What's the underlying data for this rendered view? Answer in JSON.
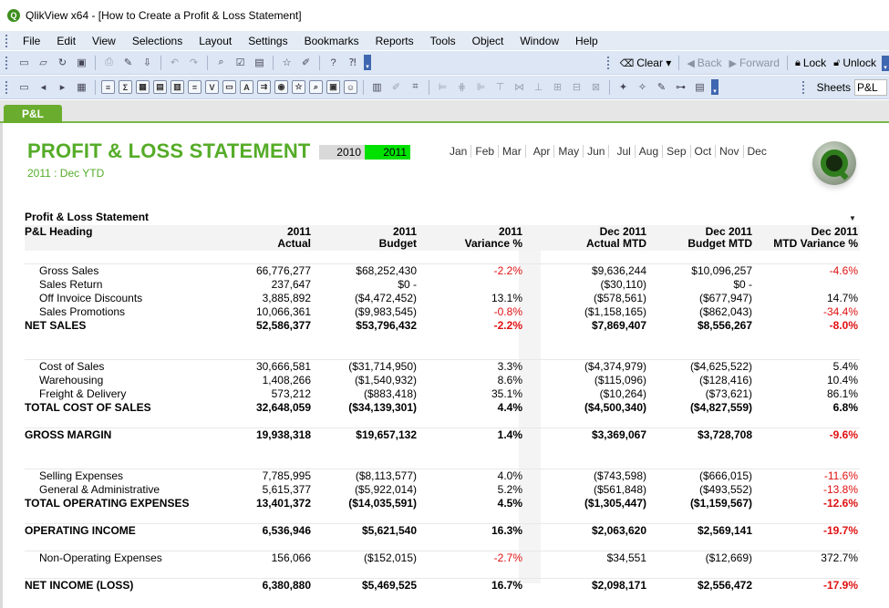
{
  "window": {
    "title": "QlikView x64 - [How to Create a Profit & Loss Statement]",
    "logo_letter": "Q"
  },
  "menu": [
    "File",
    "Edit",
    "View",
    "Selections",
    "Layout",
    "Settings",
    "Bookmarks",
    "Reports",
    "Tools",
    "Object",
    "Window",
    "Help"
  ],
  "toolbar": {
    "clear_label": "Clear",
    "back_label": "Back",
    "forward_label": "Forward",
    "lock_label": "Lock",
    "unlock_label": "Unlock",
    "sheets_label": "Sheets",
    "sheets_value": "P&L"
  },
  "sheet_tab": "P&L",
  "page": {
    "title": "PROFIT & LOSS STATEMENT",
    "subtitle": "2011 : Dec YTD",
    "years": [
      {
        "label": "2010",
        "selected": false
      },
      {
        "label": "2011",
        "selected": true
      }
    ],
    "months": [
      "Jan",
      "Feb",
      "Mar",
      "Apr",
      "May",
      "Jun",
      "Jul",
      "Aug",
      "Sep",
      "Oct",
      "Nov",
      "Dec"
    ],
    "selected_color": "#00e100",
    "brand_color": "#55ac28"
  },
  "table": {
    "caption": "Profit & Loss Statement",
    "menu_glyph": "▼",
    "headers": [
      [
        "P&L Heading",
        ""
      ],
      [
        "2011",
        "Actual"
      ],
      [
        "2011",
        "Budget"
      ],
      [
        "2011",
        "Variance %"
      ],
      [
        "Dec 2011",
        "Actual MTD"
      ],
      [
        "Dec 2011",
        "Budget MTD"
      ],
      [
        "Dec 2011",
        "MTD Variance %"
      ]
    ],
    "rows": [
      {
        "type": "blank",
        "line": true
      },
      {
        "type": "item",
        "cells": [
          "Gross Sales",
          "66,776,277",
          "$68,252,430",
          "-2.2%",
          "$9,636,244",
          "$10,096,257",
          "-4.6%"
        ],
        "neg": [
          3,
          6
        ]
      },
      {
        "type": "item",
        "cells": [
          "Sales Return",
          "237,647",
          "$0 -",
          "",
          "($30,110)",
          "$0 -",
          ""
        ],
        "neg": []
      },
      {
        "type": "item",
        "cells": [
          "Off Invoice Discounts",
          "3,885,892",
          "($4,472,452)",
          "13.1%",
          "($578,561)",
          "($677,947)",
          "14.7%"
        ],
        "neg": []
      },
      {
        "type": "item",
        "cells": [
          "Sales Promotions",
          "10,066,361",
          "($9,983,545)",
          "-0.8%",
          "($1,158,165)",
          "($862,043)",
          "-34.4%"
        ],
        "neg": [
          3,
          6
        ]
      },
      {
        "type": "total",
        "cells": [
          "NET SALES",
          "52,586,377",
          "$53,796,432",
          "-2.2%",
          "$7,869,407",
          "$8,556,267",
          "-8.0%"
        ],
        "neg": [
          3,
          6
        ]
      },
      {
        "type": "blank",
        "line": false
      },
      {
        "type": "blank",
        "line": true
      },
      {
        "type": "item",
        "cells": [
          "Cost of Sales",
          "30,666,581",
          "($31,714,950)",
          "3.3%",
          "($4,374,979)",
          "($4,625,522)",
          "5.4%"
        ],
        "neg": []
      },
      {
        "type": "item",
        "cells": [
          "Warehousing",
          "1,408,266",
          "($1,540,932)",
          "8.6%",
          "($115,096)",
          "($128,416)",
          "10.4%"
        ],
        "neg": []
      },
      {
        "type": "item",
        "cells": [
          "Freight & Delivery",
          "573,212",
          "($883,418)",
          "35.1%",
          "($10,264)",
          "($73,621)",
          "86.1%"
        ],
        "neg": []
      },
      {
        "type": "total",
        "cells": [
          "TOTAL COST OF SALES",
          "32,648,059",
          "($34,139,301)",
          "4.4%",
          "($4,500,340)",
          "($4,827,559)",
          "6.8%"
        ],
        "neg": []
      },
      {
        "type": "blank",
        "line": true
      },
      {
        "type": "total",
        "cells": [
          "GROSS MARGIN",
          "19,938,318",
          "$19,657,132",
          "1.4%",
          "$3,369,067",
          "$3,728,708",
          "-9.6%"
        ],
        "neg": [
          6
        ]
      },
      {
        "type": "blank",
        "line": false
      },
      {
        "type": "blank",
        "line": true
      },
      {
        "type": "item",
        "cells": [
          "Selling Expenses",
          "7,785,995",
          "($8,113,577)",
          "4.0%",
          "($743,598)",
          "($666,015)",
          "-11.6%"
        ],
        "neg": [
          6
        ]
      },
      {
        "type": "item",
        "cells": [
          "General & Administrative",
          "5,615,377",
          "($5,922,014)",
          "5.2%",
          "($561,848)",
          "($493,552)",
          "-13.8%"
        ],
        "neg": [
          6
        ]
      },
      {
        "type": "total",
        "cells": [
          "TOTAL OPERATING EXPENSES",
          "13,401,372",
          "($14,035,591)",
          "4.5%",
          "($1,305,447)",
          "($1,159,567)",
          "-12.6%"
        ],
        "neg": [
          6
        ]
      },
      {
        "type": "blank",
        "line": true
      },
      {
        "type": "total",
        "cells": [
          "OPERATING INCOME",
          "6,536,946",
          "$5,621,540",
          "16.3%",
          "$2,063,620",
          "$2,569,141",
          "-19.7%"
        ],
        "neg": [
          6
        ]
      },
      {
        "type": "blank",
        "line": true
      },
      {
        "type": "item",
        "cells": [
          "Non-Operating Expenses",
          "156,066",
          "($152,015)",
          "-2.7%",
          "$34,551",
          "($12,669)",
          "372.7%"
        ],
        "neg": [
          3
        ]
      },
      {
        "type": "blank",
        "line": true
      },
      {
        "type": "total",
        "cells": [
          "NET INCOME (LOSS)",
          "6,380,880",
          "$5,469,525",
          "16.7%",
          "$2,098,171",
          "$2,556,472",
          "-17.9%"
        ],
        "neg": [
          6
        ]
      }
    ]
  }
}
